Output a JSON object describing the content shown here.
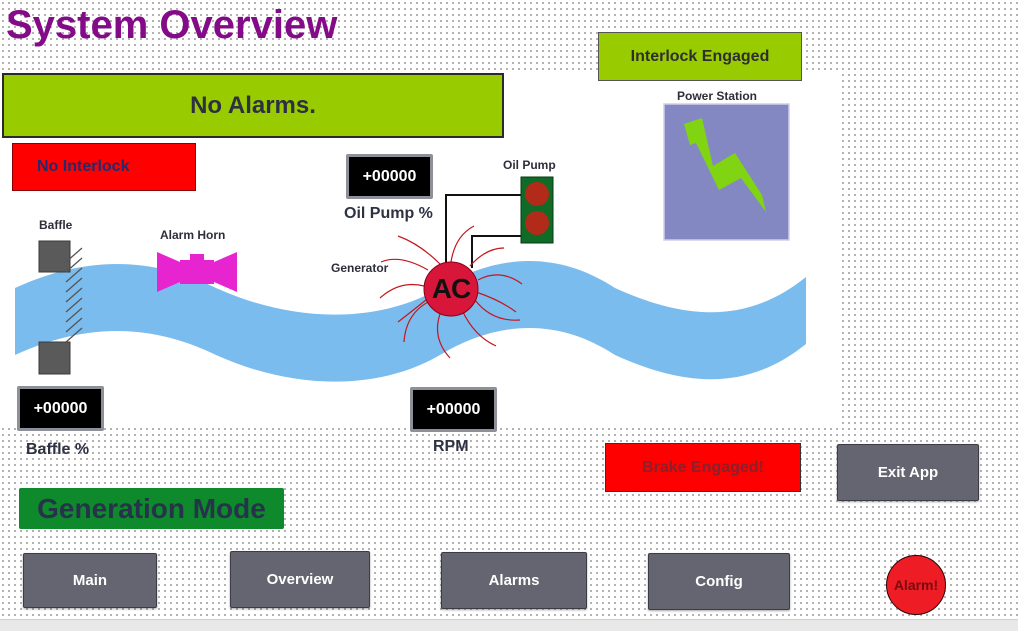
{
  "page_title": "System Overview",
  "interlock_status": "Interlock Engaged",
  "alarm_banner": "No Alarms.",
  "interlock_banner": "No Interlock",
  "brake_banner": "Brake Engaged!",
  "mode_banner": "Generation Mode",
  "diagram": {
    "baffle_label": "Baffle",
    "alarm_horn_label": "Alarm Horn",
    "generator_label": "Generator",
    "generator_symbol": "AC",
    "oil_pump_label": "Oil Pump",
    "power_station_label": "Power Station"
  },
  "readouts": {
    "oil_pump": {
      "value": "+00000",
      "label": "Oil Pump %"
    },
    "baffle": {
      "value": "+00000",
      "label": "Baffle %"
    },
    "rpm": {
      "value": "+00000",
      "label": "RPM"
    }
  },
  "buttons": {
    "exit": "Exit App",
    "main": "Main",
    "overview": "Overview",
    "alarms": "Alarms",
    "config": "Config"
  },
  "alarm_indicator": "Alarm!",
  "colors": {
    "title": "#840b87",
    "ok_green": "#99cc00",
    "alarm_red": "#ff0000",
    "mode_green": "#0e8a2c",
    "water": "#7bbcee",
    "horn": "#e625d0",
    "generator": "#d8163a",
    "power_station": "#8488c2",
    "lightning": "#80d412"
  }
}
